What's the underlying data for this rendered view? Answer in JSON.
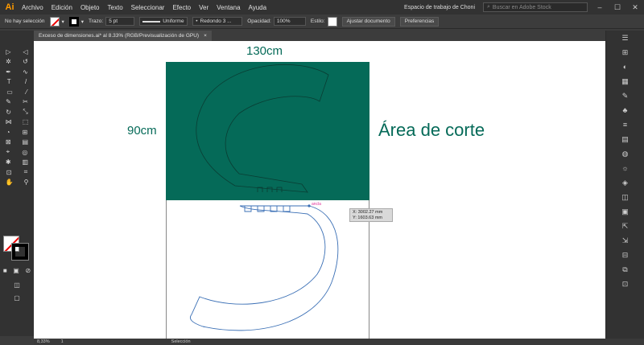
{
  "menubar": {
    "logo": "Ai",
    "items": [
      "Archivo",
      "Edición",
      "Objeto",
      "Texto",
      "Seleccionar",
      "Efecto",
      "Ver",
      "Ventana",
      "Ayuda"
    ],
    "workspace": "Espacio de trabajo de Choni",
    "search_placeholder": "Buscar en Adobe Stock"
  },
  "controlbar": {
    "selection_status": "No hay selección",
    "stroke_label": "Trazo:",
    "stroke_value": "5 pt",
    "profile": "Uniforme",
    "brush": "Redondo 3 ...",
    "opacity_label": "Opacidad:",
    "opacity_value": "100%",
    "style_label": "Estilo:",
    "doc_settings": "Ajustar documento",
    "preferences": "Preferencias"
  },
  "document": {
    "tab_title": "Exceso de dimensiones.ai* al 8.33% (RGB/Previsualización de GPU)",
    "close": "×"
  },
  "canvas": {
    "width_label": "130cm",
    "height_label": "90cm",
    "area_label": "Área de corte",
    "anchor_label": "ancla",
    "tooltip_x": "X: 3002.27 mm",
    "tooltip_y": "Y: 1603.63 mm",
    "colors": {
      "green": "#056a58",
      "path_blue": "#3a6fb5"
    }
  },
  "statusbar": {
    "zoom": "8,33%",
    "page": "1",
    "tool": "Selección"
  }
}
